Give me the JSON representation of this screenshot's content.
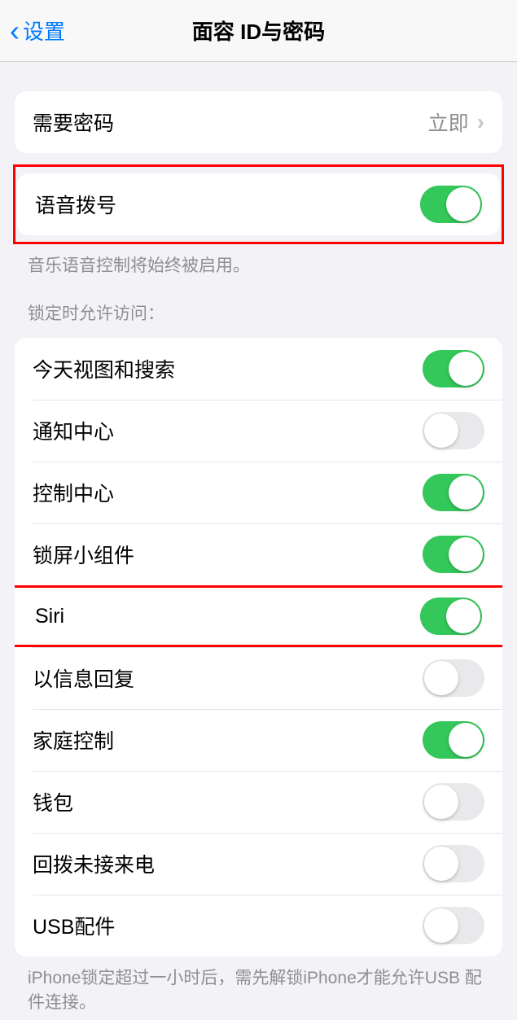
{
  "header": {
    "back_label": "设置",
    "title": "面容 ID与密码"
  },
  "require_passcode": {
    "label": "需要密码",
    "value": "立即"
  },
  "voice_dial": {
    "label": "语音拨号",
    "enabled": true,
    "footer": "音乐语音控制将始终被启用。"
  },
  "locked_access": {
    "header": "锁定时允许访问：",
    "items": [
      {
        "id": "today-view",
        "label": "今天视图和搜索",
        "enabled": true
      },
      {
        "id": "notification-center",
        "label": "通知中心",
        "enabled": false
      },
      {
        "id": "control-center",
        "label": "控制中心",
        "enabled": true
      },
      {
        "id": "lock-screen-widgets",
        "label": "锁屏小组件",
        "enabled": true
      },
      {
        "id": "siri",
        "label": "Siri",
        "enabled": true,
        "highlighted": true
      },
      {
        "id": "reply-with-message",
        "label": "以信息回复",
        "enabled": false
      },
      {
        "id": "home-control",
        "label": "家庭控制",
        "enabled": true
      },
      {
        "id": "wallet",
        "label": "钱包",
        "enabled": false
      },
      {
        "id": "return-missed-calls",
        "label": "回拨未接来电",
        "enabled": false
      },
      {
        "id": "usb-accessories",
        "label": "USB配件",
        "enabled": false
      }
    ],
    "footer": "iPhone锁定超过一小时后，需先解锁iPhone才能允许USB 配件连接。"
  }
}
